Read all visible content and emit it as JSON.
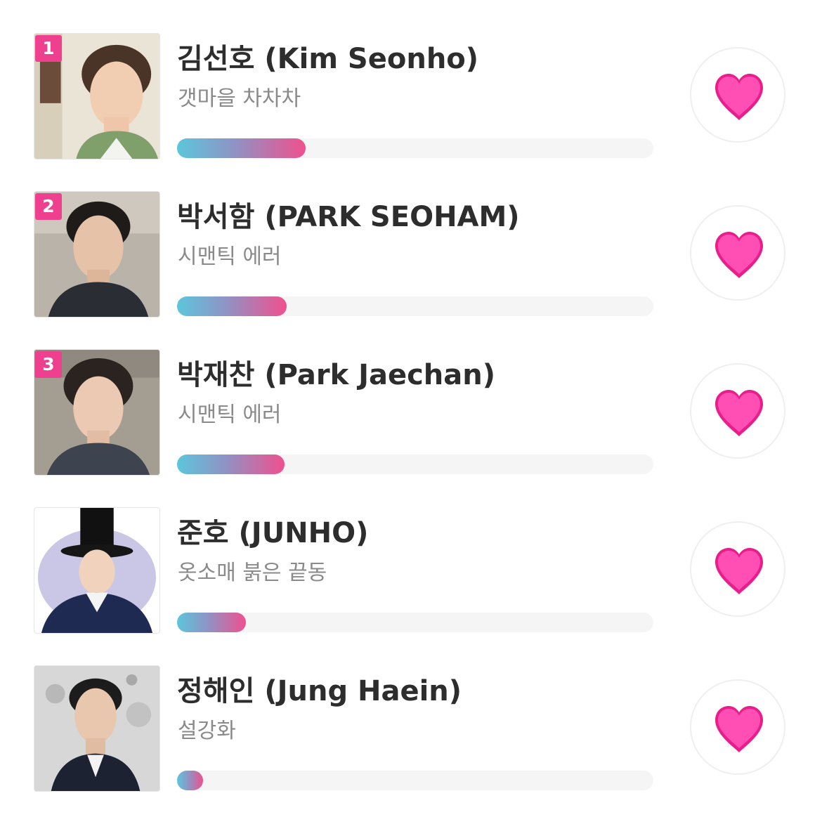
{
  "accent_color": "#ef3f8f",
  "bar_gradient": [
    "#5cc6dc",
    "#8f93c4",
    "#f0508e"
  ],
  "vote_icon": "heart-icon",
  "ranking": [
    {
      "rank": "1",
      "name": "김선호 (Kim Seonho)",
      "drama": "갯마을 차차차",
      "vote_share": 0.27
    },
    {
      "rank": "2",
      "name": "박서함 (PARK SEOHAM)",
      "drama": "시맨틱 에러",
      "vote_share": 0.23
    },
    {
      "rank": "3",
      "name": "박재찬 (Park Jaechan)",
      "drama": "시맨틱 에러",
      "vote_share": 0.225
    },
    {
      "rank": "",
      "name": "준호 (JUNHO)",
      "drama": "옷소매 붉은 끝동",
      "vote_share": 0.145
    },
    {
      "rank": "",
      "name": "정해인 (Jung Haein)",
      "drama": "설강화",
      "vote_share": 0.055
    }
  ]
}
